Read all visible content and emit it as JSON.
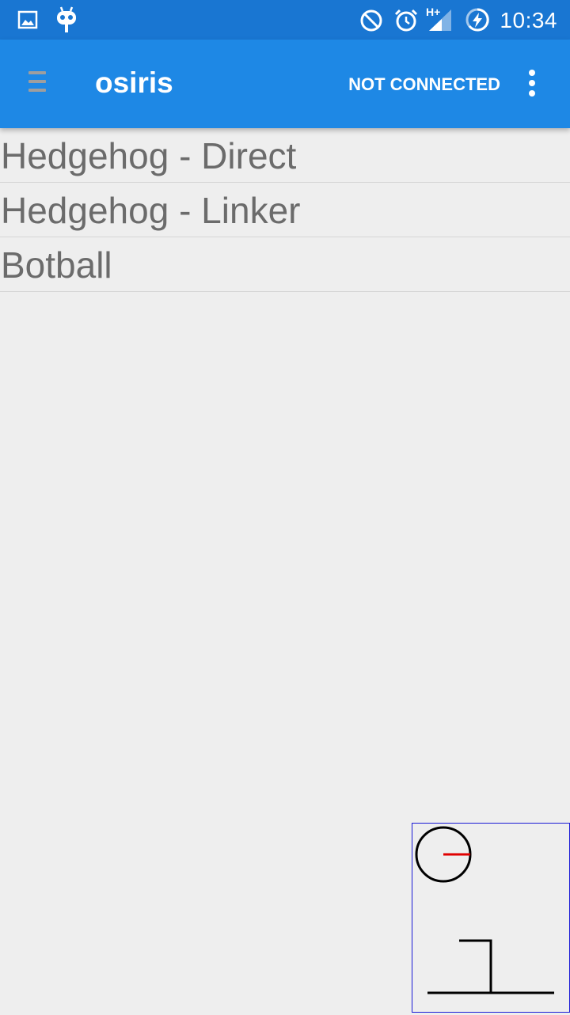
{
  "status_bar": {
    "time": "10:34",
    "network_label": "H+",
    "icons": [
      "image-icon",
      "android-icon",
      "do-not-disturb-icon",
      "alarm-icon",
      "signal-icon",
      "battery-charging-icon"
    ]
  },
  "app_bar": {
    "title": "osiris",
    "connection_status": "NOT CONNECTED",
    "menu_icon": "hamburger-menu-icon",
    "overflow_icon": "more-vert-icon"
  },
  "list": {
    "items": [
      {
        "label": "Hedgehog - Direct"
      },
      {
        "label": "Hedgehog - Linker"
      },
      {
        "label": "Botball"
      }
    ]
  },
  "colors": {
    "status_bar": "#1976d2",
    "app_bar": "#1e88e5",
    "background": "#eeeeee",
    "list_text": "#6b6b6b",
    "preview_border": "#1a1ad6",
    "robot_heading": "#e00000"
  }
}
